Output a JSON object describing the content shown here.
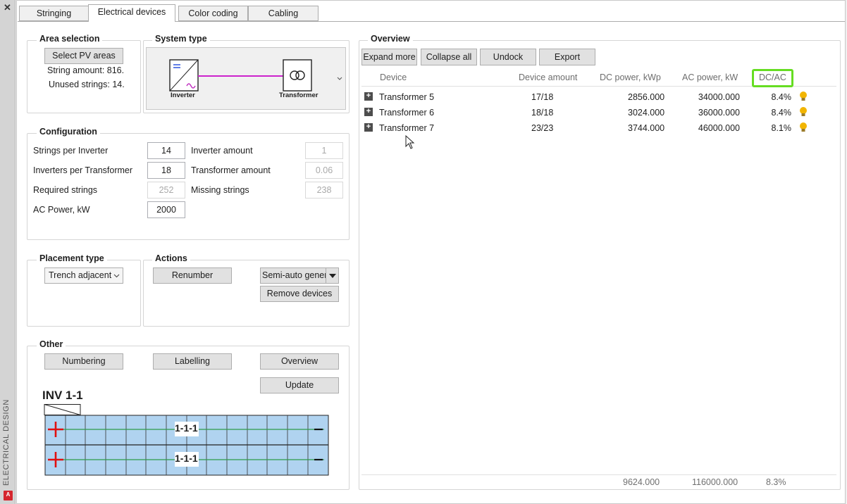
{
  "palette": {
    "title": "ELECTRICAL DESIGN",
    "logo": "A"
  },
  "tabs": [
    "Stringing",
    "Electrical devices",
    "Color coding",
    "Cabling"
  ],
  "area_selection": {
    "title": "Area selection",
    "button": "Select PV areas",
    "string_amount": "String amount: 816.",
    "unused_strings": "Unused strings: 14."
  },
  "system_type": {
    "title": "System type",
    "inverter_label": "Inverter",
    "transformer_label": "Transformer"
  },
  "configuration": {
    "title": "Configuration",
    "strings_per_inverter_label": "Strings per Inverter",
    "strings_per_inverter": "14",
    "inverters_per_transformer_label": "Inverters per Transformer",
    "inverters_per_transformer": "18",
    "required_strings_label": "Required strings",
    "required_strings": "252",
    "ac_power_label": "AC Power, kW",
    "ac_power": "2000",
    "inverter_amount_label": "Inverter amount",
    "inverter_amount": "1",
    "transformer_amount_label": "Transformer amount",
    "transformer_amount": "0.06",
    "missing_strings_label": "Missing strings",
    "missing_strings": "238"
  },
  "placement": {
    "title": "Placement type",
    "value": "Trench adjacent"
  },
  "actions": {
    "title": "Actions",
    "renumber": "Renumber",
    "semi_auto": "Semi-auto generation",
    "remove_devices": "Remove devices"
  },
  "other": {
    "title": "Other",
    "numbering": "Numbering",
    "labelling": "Labelling",
    "overview": "Overview",
    "update": "Update",
    "inv_label": "INV 1-1",
    "row_label": "1-1-1"
  },
  "overview_panel": {
    "title": "Overview",
    "buttons": [
      "Expand more",
      "Collapse all",
      "Undock",
      "Export"
    ],
    "columns": [
      "Device",
      "Device amount",
      "DC power, kWp",
      "AC power, kW",
      "DC/AC"
    ],
    "rows": [
      {
        "device": "Transformer 5",
        "amount": "17/18",
        "dc": "2856.000",
        "ac": "34000.000",
        "ratio": "8.4%"
      },
      {
        "device": "Transformer 6",
        "amount": "18/18",
        "dc": "3024.000",
        "ac": "36000.000",
        "ratio": "8.4%"
      },
      {
        "device": "Transformer 7",
        "amount": "23/23",
        "dc": "3744.000",
        "ac": "46000.000",
        "ratio": "8.1%"
      }
    ],
    "totals": {
      "dc": "9624.000",
      "ac": "116000.000",
      "ratio": "8.3%"
    },
    "highlight_color": "#66dd22"
  }
}
